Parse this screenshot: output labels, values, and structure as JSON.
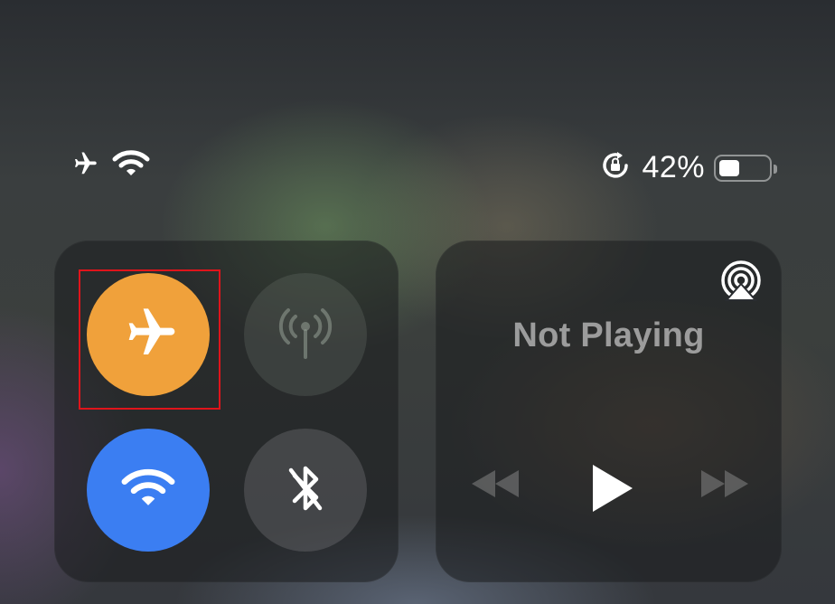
{
  "status_bar": {
    "left_icons": [
      "airplane-icon",
      "wifi-icon"
    ],
    "right_icons": [
      "orientation-lock-icon",
      "battery-icon"
    ],
    "battery_percent": "42%",
    "battery_level": 0.42
  },
  "connectivity": {
    "airplane": {
      "icon": "airplane-icon",
      "state": "on",
      "color": "#f0a13b"
    },
    "cellular": {
      "icon": "cellular-antenna-icon",
      "state": "off"
    },
    "wifi": {
      "icon": "wifi-icon",
      "state": "on",
      "color": "#3b7ef2"
    },
    "bluetooth": {
      "icon": "bluetooth-off-icon",
      "state": "off"
    }
  },
  "media": {
    "title": "Not Playing",
    "airplay_icon": "airplay-icon",
    "controls": [
      "rewind-icon",
      "play-icon",
      "fast-forward-icon"
    ]
  },
  "colors": {
    "highlight_box": "#e0141b"
  }
}
